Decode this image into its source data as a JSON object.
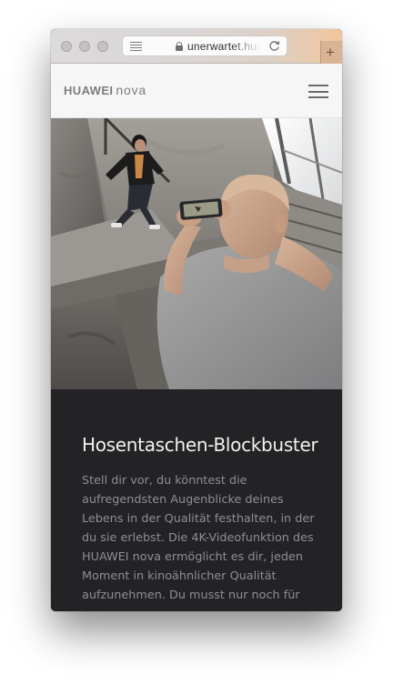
{
  "browser": {
    "url_text": "unerwartet.huawei.com",
    "new_tab_symbol": "+",
    "icons": [
      "reader-view-icon",
      "lock-icon",
      "reload-icon",
      "plus-icon"
    ],
    "window_controls": [
      "close",
      "minimize",
      "zoom"
    ]
  },
  "header": {
    "brand": "HUAWEI",
    "model": "nova",
    "menu_icon": "hamburger-menu-icon"
  },
  "hero": {
    "image": "man filming another man jumping in a concrete staircase with a smartphone"
  },
  "content": {
    "headline": "Hosentaschen-Blockbuster",
    "body": "Stell dir vor, du könntest die aufregendsten Augenblicke deines Lebens in der Qualität festhalten, in der du sie erlebst. Die 4K-Videofunktion des HUAWEI nova ermöglicht es dir, jeden Moment in kinoähnlicher Qualität aufzunehmen. Du musst nur noch für"
  },
  "colors": {
    "content_background": "#232325",
    "headline": "#f1f1f1",
    "body_text": "#8f8f93",
    "header_background": "#f6f6f6"
  }
}
